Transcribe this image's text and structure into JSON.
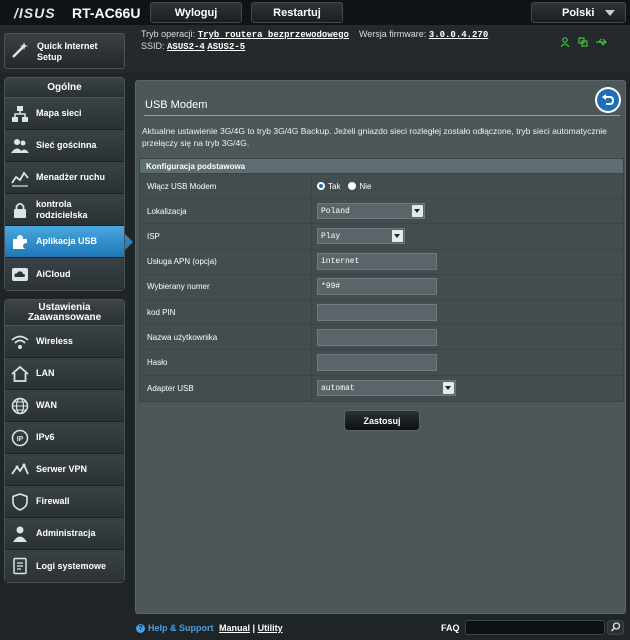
{
  "header": {
    "brand": "/ISUS",
    "model": "RT-AC66U",
    "logout_label": "Wyloguj",
    "restart_label": "Restartuj",
    "language": "Polski"
  },
  "info": {
    "mode_label": "Tryb operacji:",
    "mode_value": "Tryb routera bezprzewodowego",
    "firmware_label": "Wersja firmware:",
    "firmware_value": "3.0.0.4.270",
    "ssid_label": "SSID:",
    "ssid_1": "ASUS2-4",
    "ssid_2": "ASUS2-5"
  },
  "quick_setup": {
    "label": "Quick Internet Setup"
  },
  "sidebar": {
    "general_title": "Ogólne",
    "general_items": [
      {
        "label": "Mapa sieci"
      },
      {
        "label": "Sieć gościnna"
      },
      {
        "label": "Menadżer ruchu"
      },
      {
        "label": "kontrola rodzicielska"
      },
      {
        "label": "Aplikacja USB"
      },
      {
        "label": "AiCloud"
      }
    ],
    "advanced_title": "Ustawienia Zaawansowane",
    "advanced_items": [
      {
        "label": "Wireless"
      },
      {
        "label": "LAN"
      },
      {
        "label": "WAN"
      },
      {
        "label": "IPv6"
      },
      {
        "label": "Serwer VPN"
      },
      {
        "label": "Firewall"
      },
      {
        "label": "Administracja"
      },
      {
        "label": "Logi systemowe"
      }
    ]
  },
  "main": {
    "title": "USB Modem",
    "description": "Aktualne ustawienie 3G/4G to tryb 3G/4G Backup. Jeżeli gniazdo sieci rozległej zostało odłączone, tryb sieci automatycznie przełączy się na tryb 3G/4G.",
    "section_title": "Konfiguracja podstawowa",
    "fields": {
      "enable_label": "Włącz USB Modem",
      "enable_yes": "Tak",
      "enable_no": "Nie",
      "location_label": "Lokalizacja",
      "location_value": "Poland",
      "isp_label": "ISP",
      "isp_value": "Play",
      "apn_label": "Usługa APN (opcja)",
      "apn_value": "internet",
      "dial_label": "Wybierany numer",
      "dial_value": "*99#",
      "pin_label": "kod PIN",
      "pin_value": "",
      "user_label": "Nazwa użytkownika",
      "user_value": "",
      "pass_label": "Hasło",
      "pass_value": "",
      "adapter_label": "Adapter USB",
      "adapter_value": "automat"
    },
    "apply_label": "Zastosuj"
  },
  "footer": {
    "help": "Help & Support",
    "manual": "Manual",
    "separator": "|",
    "utility": "Utility",
    "faq": "FAQ"
  },
  "colors": {
    "accent": "#2a84c4",
    "status_green": "#3fc33f"
  }
}
